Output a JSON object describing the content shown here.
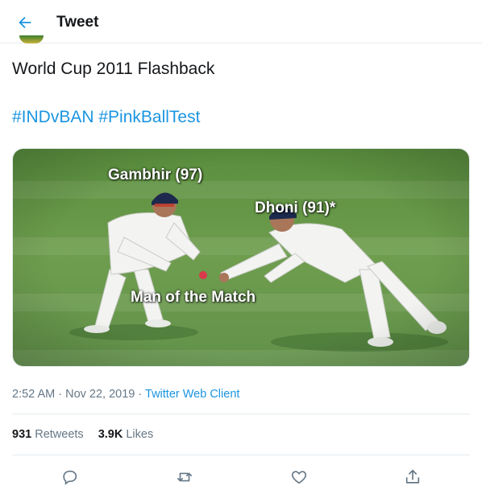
{
  "header": {
    "title": "Tweet"
  },
  "tweet": {
    "text": "World Cup 2011 Flashback",
    "hashtags": [
      "#INDvBAN",
      "#PinkBallTest"
    ],
    "media": {
      "captions": {
        "left_player": "Gambhir (97)",
        "right_player": "Dhoni (91)*",
        "center": "Man of the Match"
      }
    },
    "time": "2:52 AM",
    "separator": "·",
    "date": "Nov 22, 2019",
    "source": "Twitter Web Client"
  },
  "stats": {
    "retweets_count": "931",
    "retweets_label": "Retweets",
    "likes_count": "3.9K",
    "likes_label": "Likes"
  },
  "icons": {
    "back": "arrow-left-icon",
    "reply": "reply-icon",
    "retweet": "retweet-icon",
    "like": "heart-icon",
    "share": "share-icon"
  },
  "colors": {
    "accent": "#1b95e0",
    "text": "#14171a",
    "secondary": "#657786",
    "border": "#e6ecf0"
  }
}
